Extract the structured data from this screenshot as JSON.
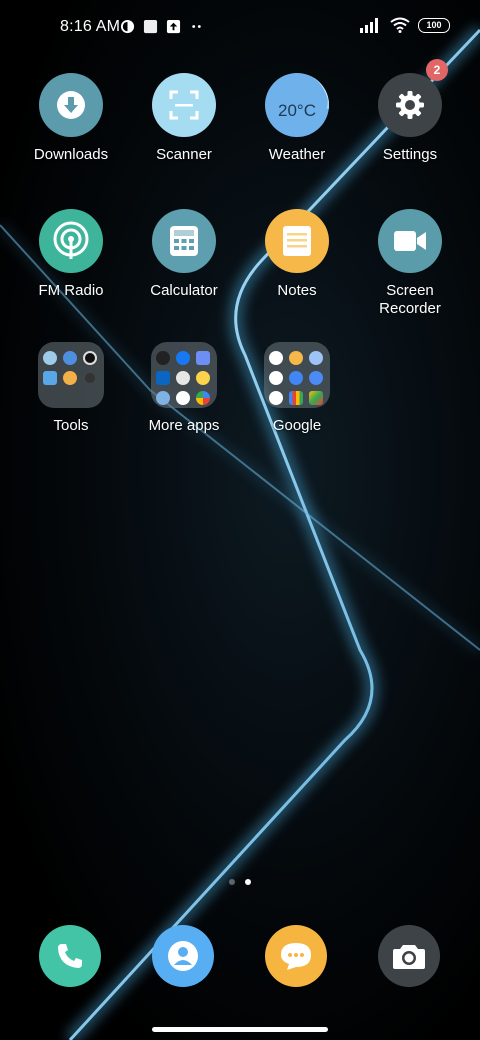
{
  "status_bar": {
    "time": "8:16 AM",
    "battery": "100",
    "icons": [
      "notification-icon",
      "square-icon",
      "upload-icon",
      "more-dots-icon",
      "signal-icon",
      "wifi-icon",
      "battery-icon"
    ]
  },
  "apps": [
    {
      "label": "Downloads",
      "icon": "download-icon",
      "color": "#5b9bab"
    },
    {
      "label": "Scanner",
      "icon": "scanner-icon",
      "color": "#a5dcf2"
    },
    {
      "label": "Weather",
      "icon": "weather-icon",
      "color": "#6fb1ea",
      "value": "20°C"
    },
    {
      "label": "Settings",
      "icon": "gear-icon",
      "color": "#3d4347",
      "badge": "2"
    },
    {
      "label": "FM Radio",
      "icon": "radio-icon",
      "color": "#3eb59b"
    },
    {
      "label": "Calculator",
      "icon": "calculator-icon",
      "color": "#5d9fae"
    },
    {
      "label": "Notes",
      "icon": "notes-icon",
      "color": "#f7b84a"
    },
    {
      "label": "Screen Recorder",
      "icon": "video-camera-icon",
      "color": "#5a9caa"
    }
  ],
  "folders": [
    {
      "label": "Tools"
    },
    {
      "label": "More apps"
    },
    {
      "label": "Google"
    }
  ],
  "dock": [
    {
      "name": "phone-icon",
      "color": "#43c4a6"
    },
    {
      "name": "contacts-icon",
      "color": "#58aef2"
    },
    {
      "name": "messages-icon",
      "color": "#f5b540"
    },
    {
      "name": "camera-icon",
      "color": "#3d4347"
    }
  ],
  "pager": {
    "pages": 2,
    "current": 2
  }
}
